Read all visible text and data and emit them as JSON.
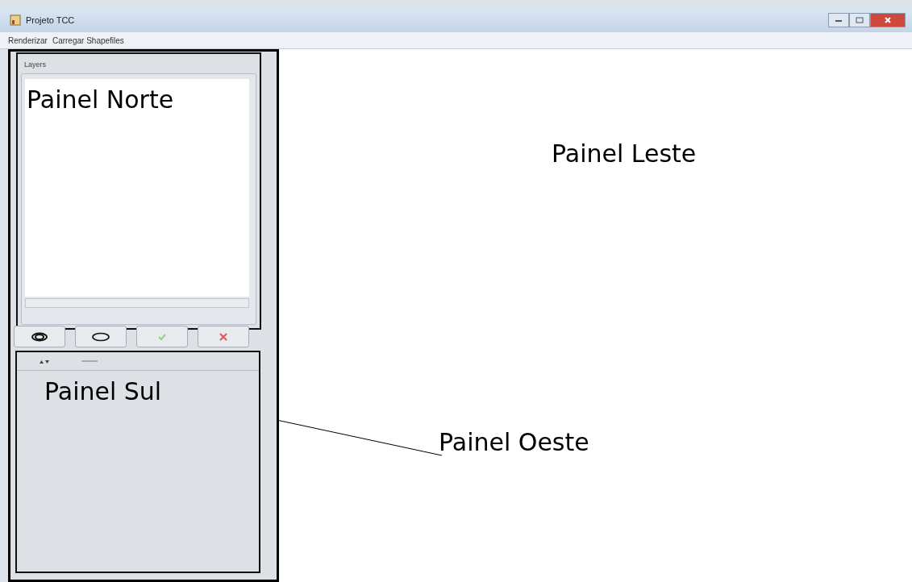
{
  "window": {
    "title": "Projeto TCC"
  },
  "menu": [
    "Renderizar",
    "Carregar Shapefiles"
  ],
  "layers_panel": {
    "title": "Layers"
  },
  "layer_buttons": [
    {
      "kind": "eye"
    },
    {
      "kind": "ellipse"
    },
    {
      "kind": "check"
    },
    {
      "kind": "delete"
    }
  ],
  "annotations": {
    "north": "Painel Norte",
    "south": "Painel Sul",
    "east": "Painel Leste",
    "west": "Painel Oeste"
  }
}
